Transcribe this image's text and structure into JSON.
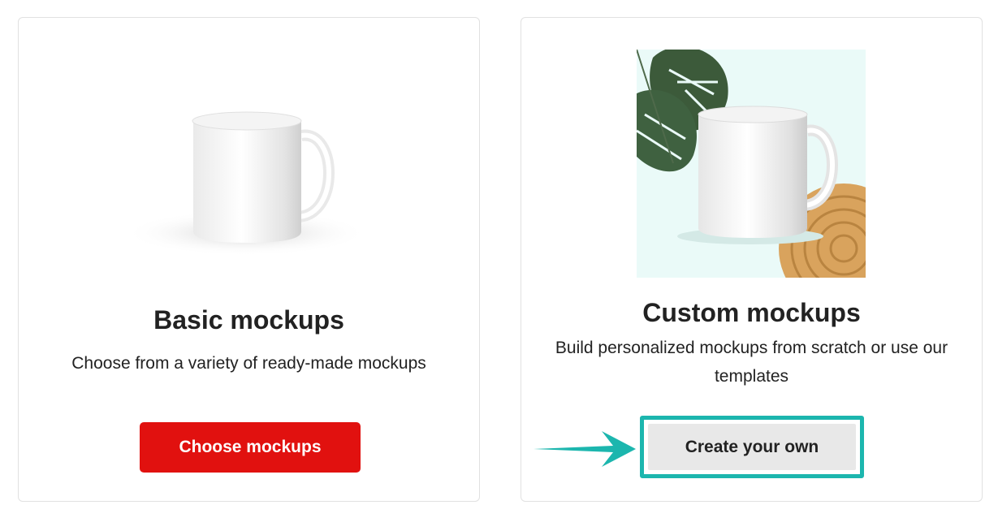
{
  "cards": [
    {
      "title": "Basic mockups",
      "description": "Choose from a variety of ready-made mockups",
      "button_label": "Choose mockups"
    },
    {
      "title": "Custom mockups",
      "description": "Build personalized mockups from scratch or use our templates",
      "button_label": "Create your own"
    }
  ],
  "colors": {
    "primary_button": "#e1110f",
    "secondary_button": "#e8e8e8",
    "highlight": "#1cb6ae",
    "card_border": "#e1e1e1",
    "text": "#222222"
  },
  "icons": [
    "mug-image",
    "mug-with-plant-image",
    "pointer-arrow-icon"
  ]
}
